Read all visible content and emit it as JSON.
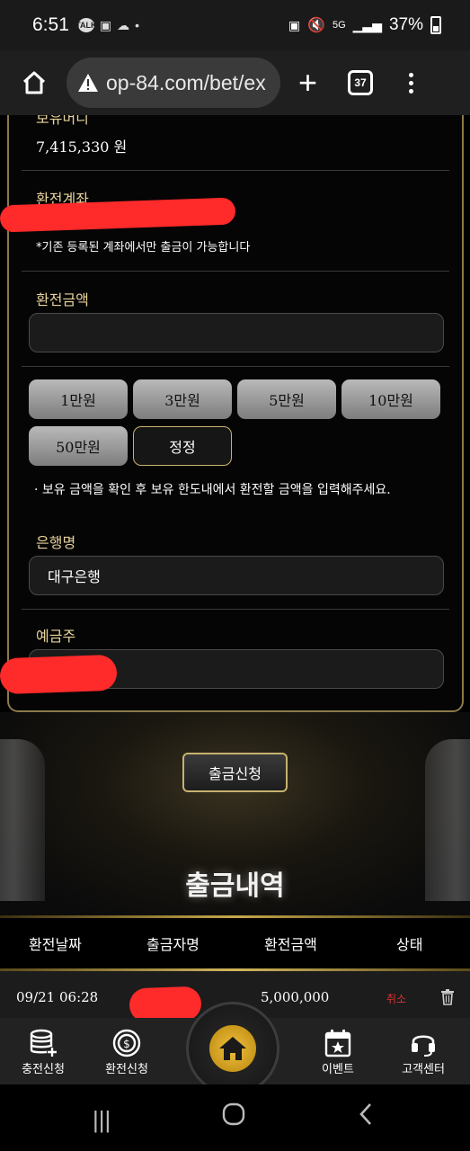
{
  "status": {
    "time": "6:51",
    "notifications": [
      "TALK",
      "image",
      "cloud",
      "•"
    ],
    "battery": "37%",
    "network": "5G"
  },
  "browser": {
    "url": "op-84.com/bet/ex",
    "tab_count": "37"
  },
  "form": {
    "balance_label": "보유머니",
    "balance_value": "7,415,330 원",
    "account_label": "환전계좌",
    "account_note": "*기존 등록된 계좌에서만 출금이 가능합니다",
    "amount_label": "환전금액",
    "amount_value": "",
    "amount_buttons": [
      "1만원",
      "3만원",
      "5만원",
      "10만원",
      "50만원",
      "정정"
    ],
    "amount_note": "· 보유 금액을 확인 후 보유 한도내에서 환전할 금액을 입력해주세요.",
    "bank_label": "은행명",
    "bank_value": "대구은행",
    "holder_label": "예금주",
    "holder_value": ""
  },
  "apply_button": "출금신청",
  "history": {
    "title": "출금내역",
    "columns": [
      "환전날짜",
      "출금자명",
      "환전금액",
      "상태"
    ],
    "rows": [
      {
        "date": "09/21 06:28",
        "name": "",
        "amount": "5,000,000",
        "status": "취소"
      }
    ]
  },
  "bottom_nav": {
    "items": [
      "충전신청",
      "환전신청",
      "",
      "이벤트",
      "고객센터"
    ]
  },
  "colors": {
    "gold": "#c7b26e",
    "label_gold": "#e6d29a",
    "cancel_red": "#e03030"
  }
}
